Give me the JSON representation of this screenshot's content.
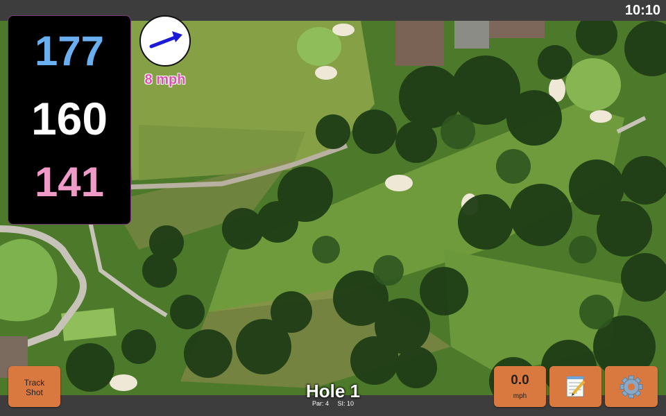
{
  "status_bar": {
    "time": "10:10"
  },
  "yardage": {
    "back": "177",
    "middle": "160",
    "front": "141",
    "colors": {
      "back": "#6ab0f0",
      "middle": "#ffffff",
      "front": "#f09ac8"
    }
  },
  "wind": {
    "speed": "8 mph",
    "direction_icon": "arrow-icon",
    "color": "#1a1ad8",
    "speed_color": "#e04fa8"
  },
  "track_shot": {
    "label_line1": "Track",
    "label_line2": "Shot"
  },
  "shot_speed": {
    "value": "0.0",
    "unit": "mph"
  },
  "notes": {
    "icon": "notepad-icon"
  },
  "settings": {
    "icon": "gear-icon"
  },
  "hole": {
    "title": "Hole 1",
    "par": "Par: 4",
    "si": "SI: 10"
  },
  "colors": {
    "button": "#d9783f",
    "fairway": "#6e9a3e",
    "rough": "#4f7a2c"
  }
}
